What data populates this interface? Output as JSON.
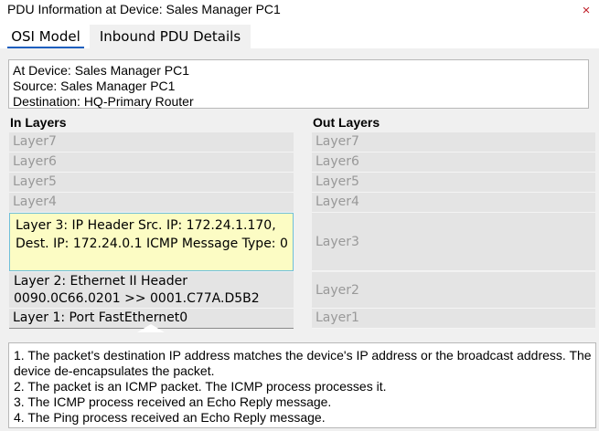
{
  "window": {
    "title": "PDU Information at Device: Sales Manager PC1",
    "close_label": "×"
  },
  "tabs": [
    {
      "label": "OSI Model",
      "active": true
    },
    {
      "label": "Inbound PDU Details",
      "active": false
    }
  ],
  "info": {
    "device": "At Device: Sales Manager PC1",
    "source": "Source: Sales Manager PC1",
    "destination": "Destination: HQ-Primary Router"
  },
  "in_layers": {
    "header": "In Layers",
    "items": [
      "Layer7",
      "Layer6",
      "Layer5",
      "Layer4",
      "Layer 3: IP Header Src. IP: 172.24.1.170, Dest. IP: 172.24.0.1 ICMP Message Type: 0",
      "Layer 2: Ethernet II Header 0090.0C66.0201 >> 0001.C77A.D5B2",
      "Layer 1: Port FastEthernet0"
    ]
  },
  "out_layers": {
    "header": "Out Layers",
    "items": [
      "Layer7",
      "Layer6",
      "Layer5",
      "Layer4",
      "Layer3",
      "Layer2",
      "Layer1"
    ]
  },
  "description": [
    "1. The packet's destination IP address matches the device's IP address or the broadcast address. The device de-encapsulates the packet.",
    "2. The packet is an ICMP packet. The ICMP process processes it.",
    "3. The ICMP process received an Echo Reply message.",
    "4. The Ping process received an Echo Reply message."
  ],
  "colors": {
    "highlight_fill": "#fcfcc4",
    "highlight_border": "#6fbfd8",
    "tab_underline": "#1e5fbf",
    "close_icon": "#c0202a"
  }
}
